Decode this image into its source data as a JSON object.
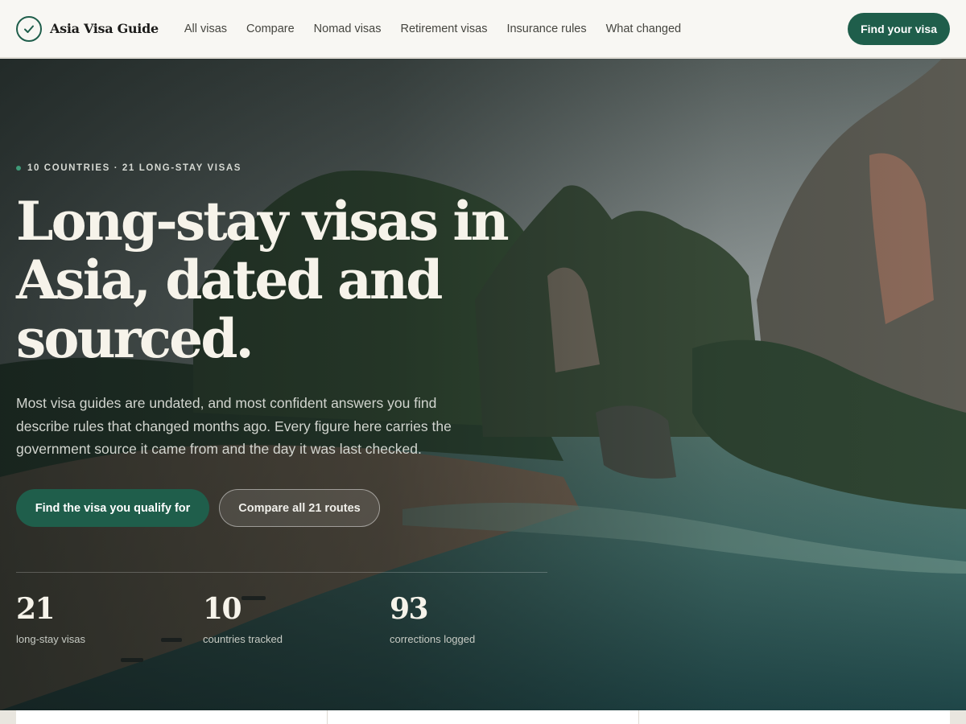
{
  "header": {
    "brand": "Asia Visa Guide",
    "nav": [
      "All visas",
      "Compare",
      "Nomad visas",
      "Retirement visas",
      "Insurance rules",
      "What changed"
    ],
    "cta": "Find your visa"
  },
  "hero": {
    "eyebrow": "10 COUNTRIES · 21 LONG-STAY VISAS",
    "headline": "Long-stay visas in Asia, dated and sourced.",
    "lede": "Most visa guides are undated, and most confident answers you find describe rules that changed months ago. Every figure here carries the government source it came from and the day it was last checked.",
    "primary_cta": "Find the visa you qualify for",
    "secondary_cta": "Compare all 21 routes",
    "stats": [
      {
        "value": "21",
        "label": "long-stay visas"
      },
      {
        "value": "10",
        "label": "countries tracked"
      },
      {
        "value": "93",
        "label": "corrections logged"
      }
    ]
  },
  "colors": {
    "accent": "#1f5e4b",
    "header_bg": "#f8f7f3",
    "headline": "#f6f3ea"
  },
  "icons": {
    "brand": "check-circle-icon"
  }
}
